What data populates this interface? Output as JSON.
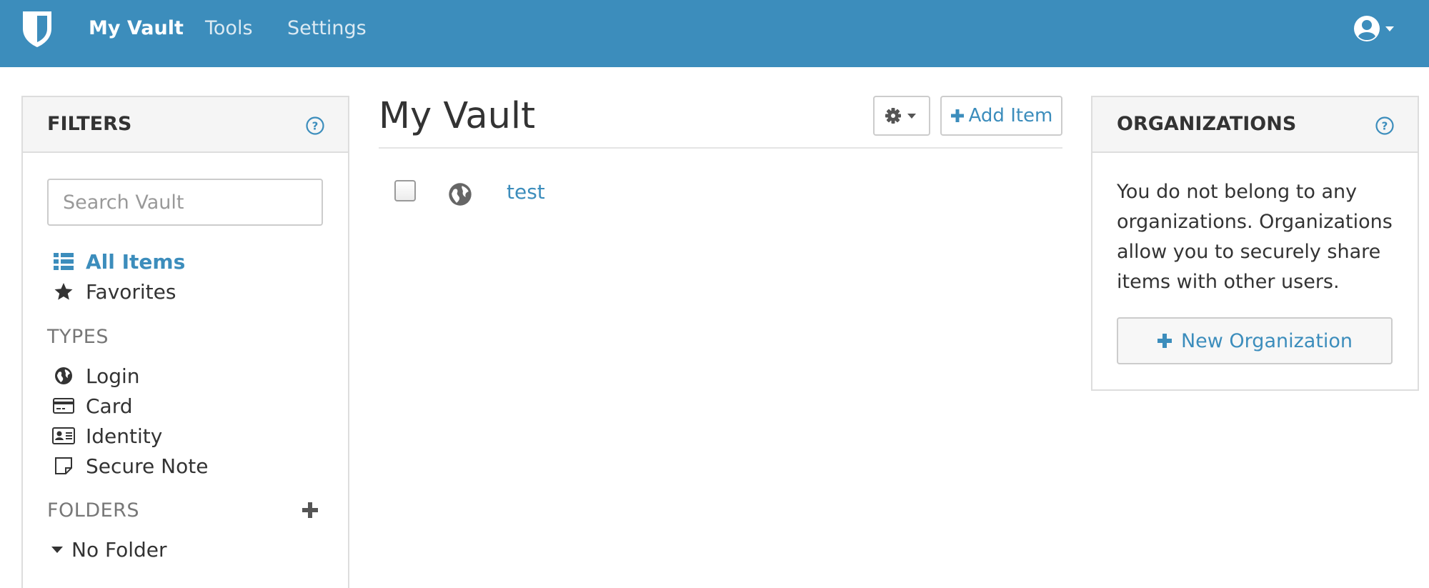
{
  "nav": {
    "brand_icon": "shield-icon",
    "links": [
      {
        "label": "My Vault",
        "active": true
      },
      {
        "label": "Tools",
        "active": false
      },
      {
        "label": "Settings",
        "active": false
      }
    ],
    "account_icon": "user-circle-icon",
    "color": "#3c8dbc"
  },
  "filters": {
    "title": "FILTERS",
    "search_placeholder": "Search Vault",
    "all_items": "All Items",
    "favorites": "Favorites",
    "types_label": "TYPES",
    "types": [
      "Login",
      "Card",
      "Identity",
      "Secure Note"
    ],
    "folders_label": "FOLDERS",
    "no_folder": "No Folder"
  },
  "main": {
    "title": "My Vault",
    "add_item_label": "Add Item",
    "items": [
      {
        "name": "test",
        "icon": "globe-icon"
      }
    ]
  },
  "organizations": {
    "title": "ORGANIZATIONS",
    "description": "You do not belong to any organizations. Organizations allow you to securely share items with other users.",
    "new_org_label": "New Organization"
  },
  "colors": {
    "accent": "#3c8dbc",
    "panel_header": "#f5f5f5",
    "border": "#dddddd"
  }
}
